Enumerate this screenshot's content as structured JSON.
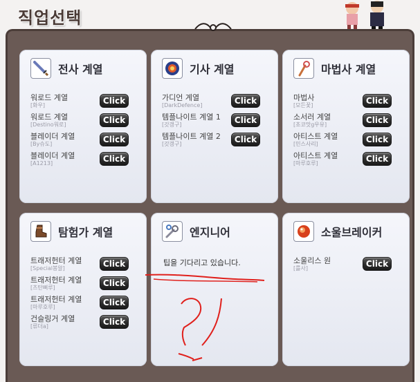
{
  "page_title": "직업선택",
  "click_label": "Click",
  "colors": {
    "board": "#6a5a55",
    "frame": "#4b3d39",
    "panel": "#eef0f6",
    "button": "#2c2c2c",
    "scribble": "#e0201c"
  },
  "panels": [
    {
      "title": "전사 계열",
      "icon": "sword-icon",
      "jobs": [
        {
          "name": "워로드 계열",
          "author": "[화우]"
        },
        {
          "name": "워로드 계열",
          "author": "[Destino워로]"
        },
        {
          "name": "블레이더 계열",
          "author": "[By슈도]"
        },
        {
          "name": "블레이더 계열",
          "author": "[A1213]"
        }
      ]
    },
    {
      "title": "기사 계열",
      "icon": "knight-emblem-icon",
      "jobs": [
        {
          "name": "가디언 계열",
          "author": "[DarkDefence]"
        },
        {
          "name": "템플나이트 계열 1",
          "author": "[갓갱구]"
        },
        {
          "name": "템플나이트 계열 2",
          "author": "[갓갱구]"
        }
      ]
    },
    {
      "title": "마법사 계열",
      "icon": "magic-staff-icon",
      "jobs": [
        {
          "name": "마법사",
          "author": "[모든꽃]"
        },
        {
          "name": "소서러 계열",
          "author": "[초코맛g우유]"
        },
        {
          "name": "아티스트 계열",
          "author": "[민스사리]"
        },
        {
          "name": "아티스트 계열",
          "author": "[마루호루]"
        }
      ]
    },
    {
      "title": "탐험가 계열",
      "icon": "boot-icon",
      "jobs": [
        {
          "name": "트래저헌터 계열",
          "author": "[Special봉알]"
        },
        {
          "name": "트래저헌터 계열",
          "author": "[츠탄뻐루]"
        },
        {
          "name": "트래저헌터 계열",
          "author": "[마루호루]"
        },
        {
          "name": "건슬링거 계열",
          "author": "[류더a]"
        }
      ]
    },
    {
      "title": "엔지니어",
      "icon": "wrench-icon",
      "jobs": [],
      "message": "팁을 기다리고 있습니다."
    },
    {
      "title": "소울브레이커",
      "icon": "soul-orb-icon",
      "jobs": [
        {
          "name": "소울리스 원",
          "author": "[를사]"
        }
      ]
    }
  ]
}
